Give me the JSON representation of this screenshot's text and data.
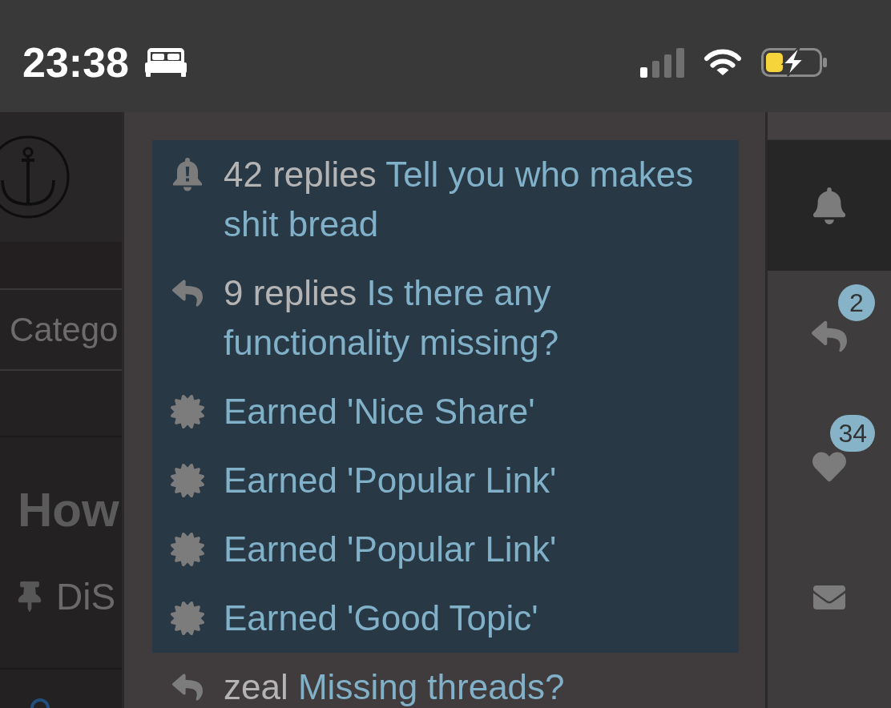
{
  "status_bar": {
    "time": "23:38"
  },
  "background_page": {
    "category_label": "Catego",
    "topic_title": "How",
    "topic_pinned": true,
    "topic_label": "DiS"
  },
  "notifications": [
    {
      "kind": "watching",
      "unread": true,
      "prefix": "42 replies",
      "title": "Tell you who makes shit bread"
    },
    {
      "kind": "reply",
      "unread": true,
      "prefix": "9 replies",
      "title": "Is there any functionality missing?"
    },
    {
      "kind": "badge",
      "unread": true,
      "title": "Earned 'Nice Share'"
    },
    {
      "kind": "badge",
      "unread": true,
      "title": "Earned 'Popular Link'"
    },
    {
      "kind": "badge",
      "unread": true,
      "title": "Earned 'Popular Link'"
    },
    {
      "kind": "badge",
      "unread": true,
      "title": "Earned 'Good Topic'"
    },
    {
      "kind": "reply",
      "unread": false,
      "prefix": "zeal",
      "title": "Missing threads?"
    }
  ],
  "side_tabs": [
    {
      "kind": "notifications",
      "selected": true
    },
    {
      "kind": "replies",
      "selected": false,
      "badge": "2"
    },
    {
      "kind": "likes",
      "selected": false,
      "badge": "34"
    },
    {
      "kind": "messages",
      "selected": false
    }
  ]
}
